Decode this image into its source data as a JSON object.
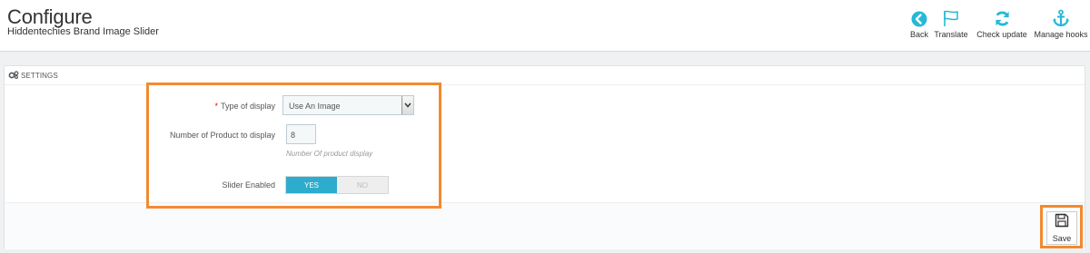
{
  "header": {
    "title": "Configure",
    "subtitle": "Hiddentechies Brand Image Slider"
  },
  "toolbar": {
    "back": {
      "label": "Back",
      "icon": "back-circle-icon"
    },
    "translate": {
      "label": "Translate",
      "icon": "flag-icon"
    },
    "check_update": {
      "label": "Check update",
      "icon": "refresh-icon"
    },
    "manage_hooks": {
      "label": "Manage hooks",
      "icon": "anchor-icon"
    }
  },
  "panel": {
    "heading": "SETTINGS",
    "heading_icon": "cogs-icon"
  },
  "form": {
    "type_of_display": {
      "required_mark": "*",
      "label": "Type of display",
      "value": "Use An Image"
    },
    "num_products": {
      "label": "Number of Product to display",
      "value": "8",
      "help": "Number Of product display"
    },
    "slider_enabled": {
      "label": "Slider Enabled",
      "yes": "YES",
      "no": "NO",
      "selected": "YES"
    }
  },
  "footer": {
    "save_label": "Save",
    "save_icon": "floppy-disk-icon"
  },
  "colors": {
    "accent": "#25b9d7",
    "toggle_on": "#2eacce",
    "highlight": "#f28a30",
    "required": "#e00000"
  }
}
